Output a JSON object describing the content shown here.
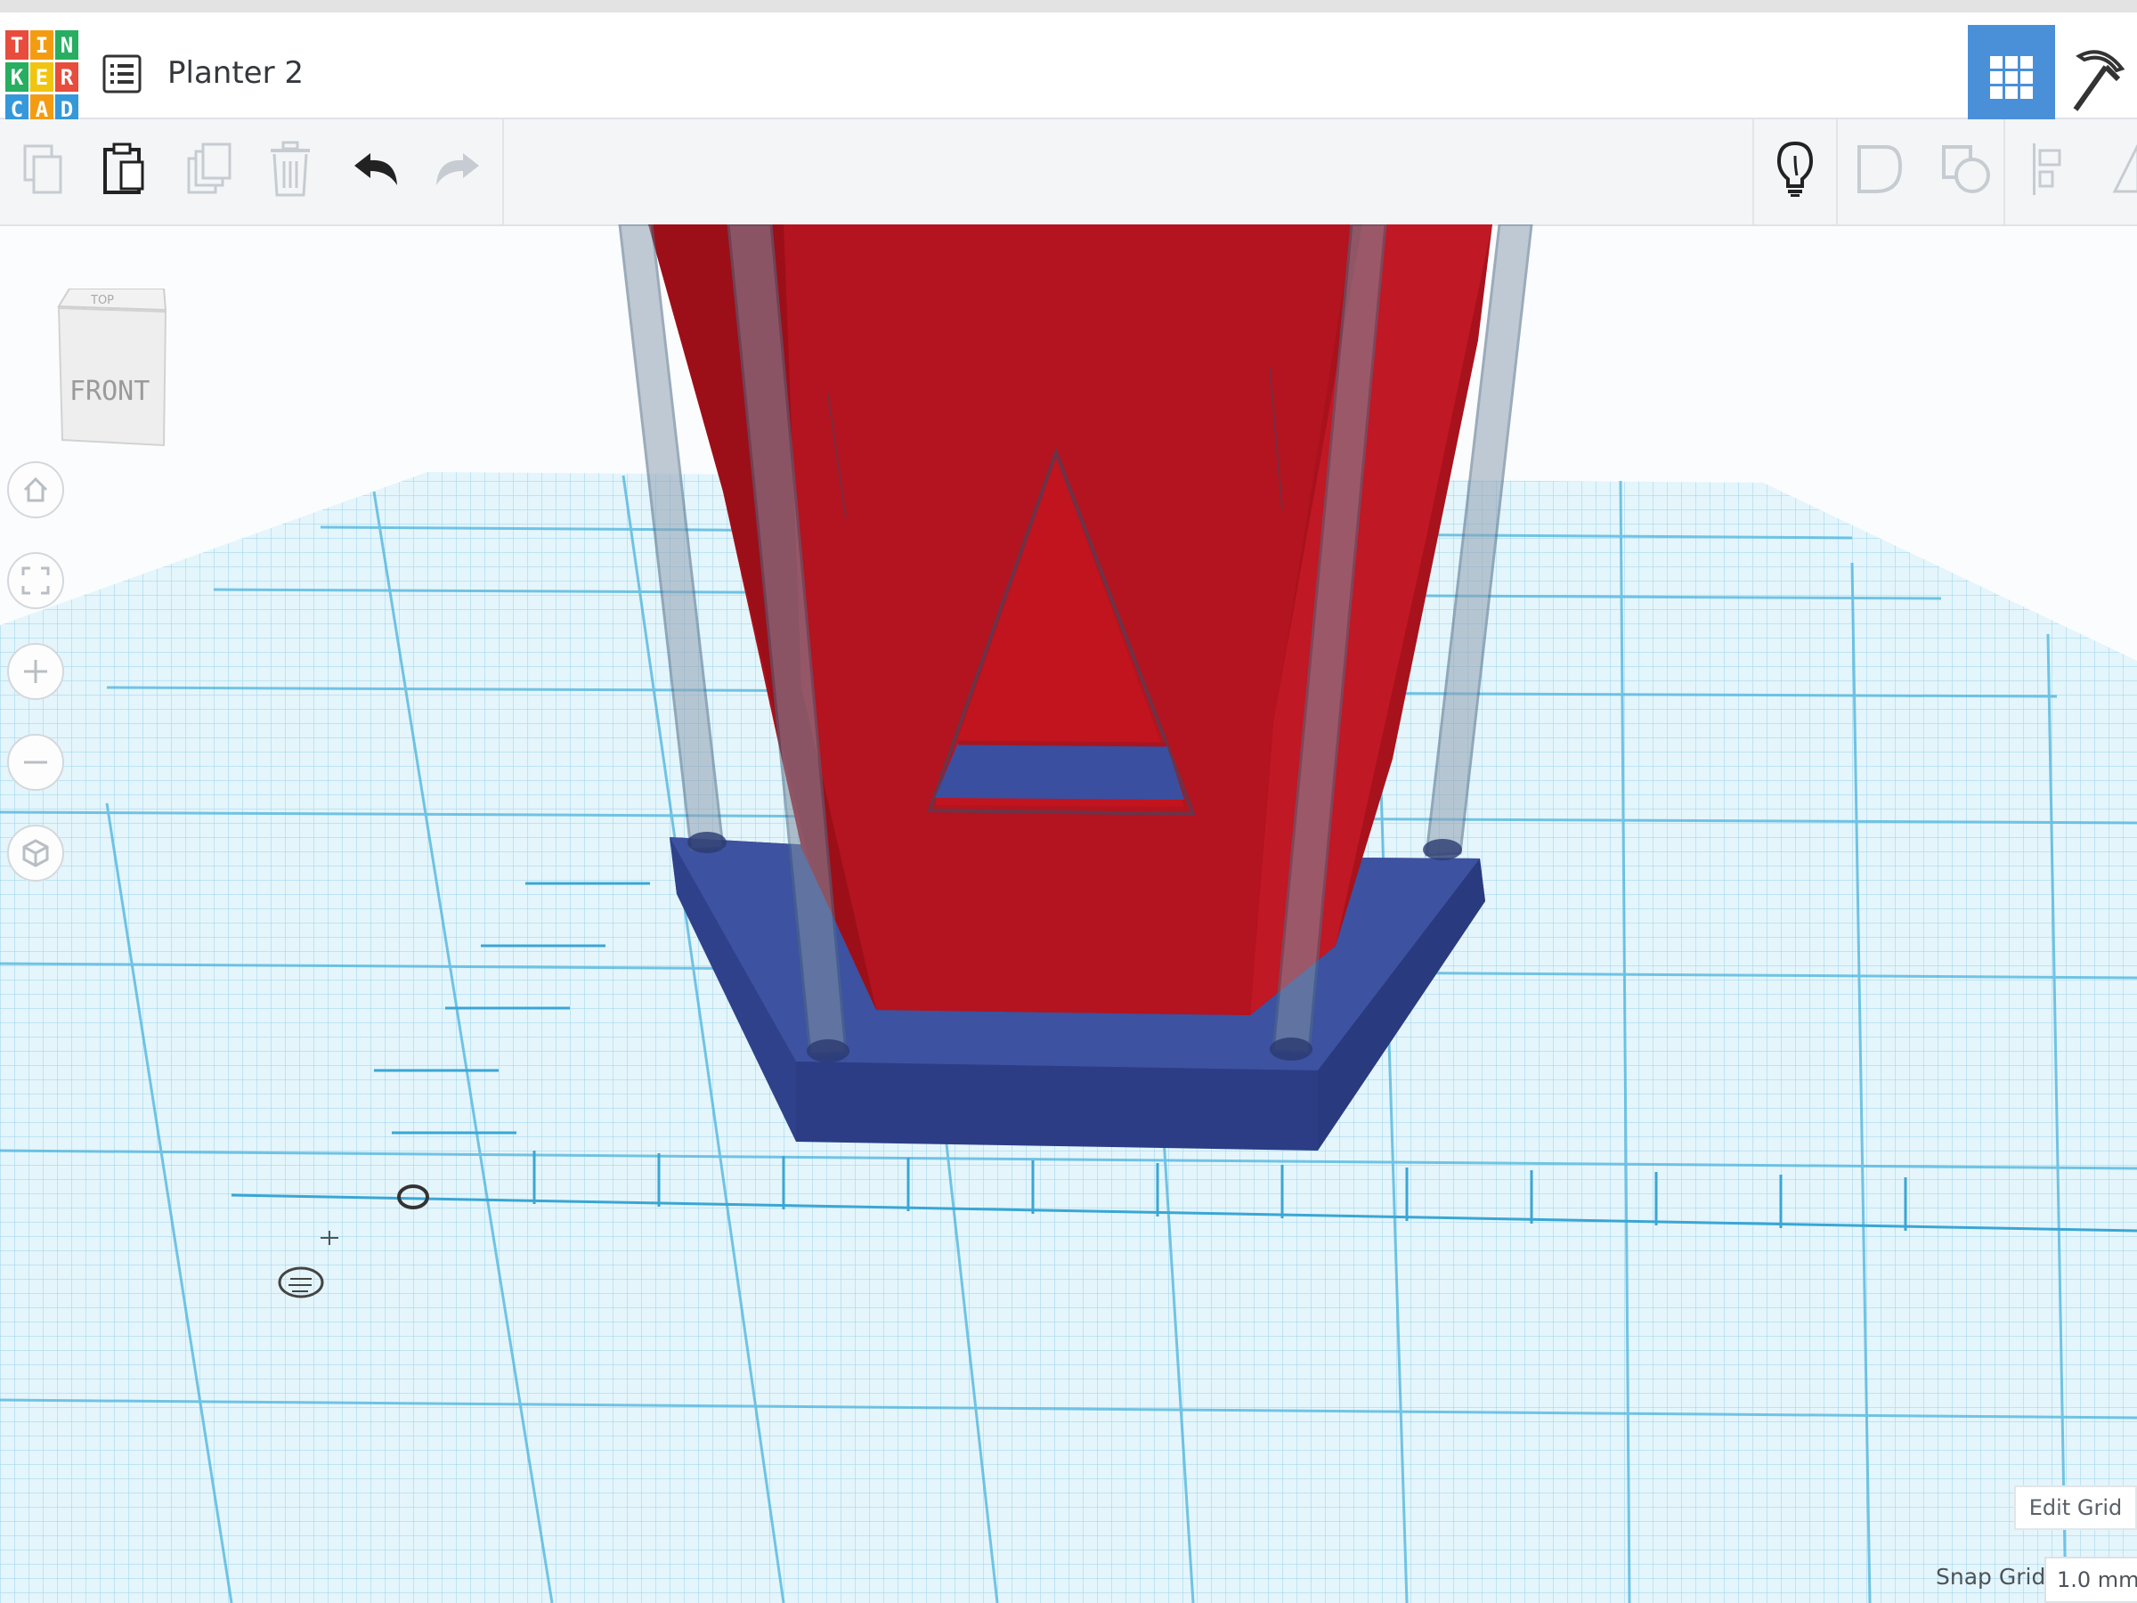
{
  "app": {
    "logo_letters": [
      "T",
      "I",
      "N",
      "K",
      "E",
      "R",
      "C",
      "A",
      "D"
    ],
    "logo_colors": [
      "#e74c3c",
      "#f39c12",
      "#27ae60",
      "#27ae60",
      "#f1c40f",
      "#e74c3c",
      "#3498db",
      "#f39c12",
      "#3498db"
    ],
    "design_title": "Planter 2"
  },
  "toolbar": {
    "buttons": [
      "copy-icon",
      "paste-icon",
      "duplicate-icon",
      "delete-icon",
      "undo-icon",
      "redo-icon",
      "bulb-icon",
      "group-icon",
      "ungroup-icon",
      "align-icon",
      "mirror-icon"
    ]
  },
  "viewcube": {
    "top_label": "TOP",
    "front_label": "FRONT"
  },
  "nav": [
    "home-view-icon",
    "fit-all-icon",
    "zoom-in-icon",
    "zoom-out-icon",
    "ortho-perspective-icon"
  ],
  "grid": {
    "edit_grid_label": "Edit Grid",
    "snap_grid_label": "Snap Grid",
    "snap_grid_value": "1.0 mm"
  },
  "colors": {
    "accent": "#4a90d9",
    "shape_red": "#b0151f",
    "shape_blue": "#3a4f9d",
    "grid_line": "#4ab3dc"
  }
}
